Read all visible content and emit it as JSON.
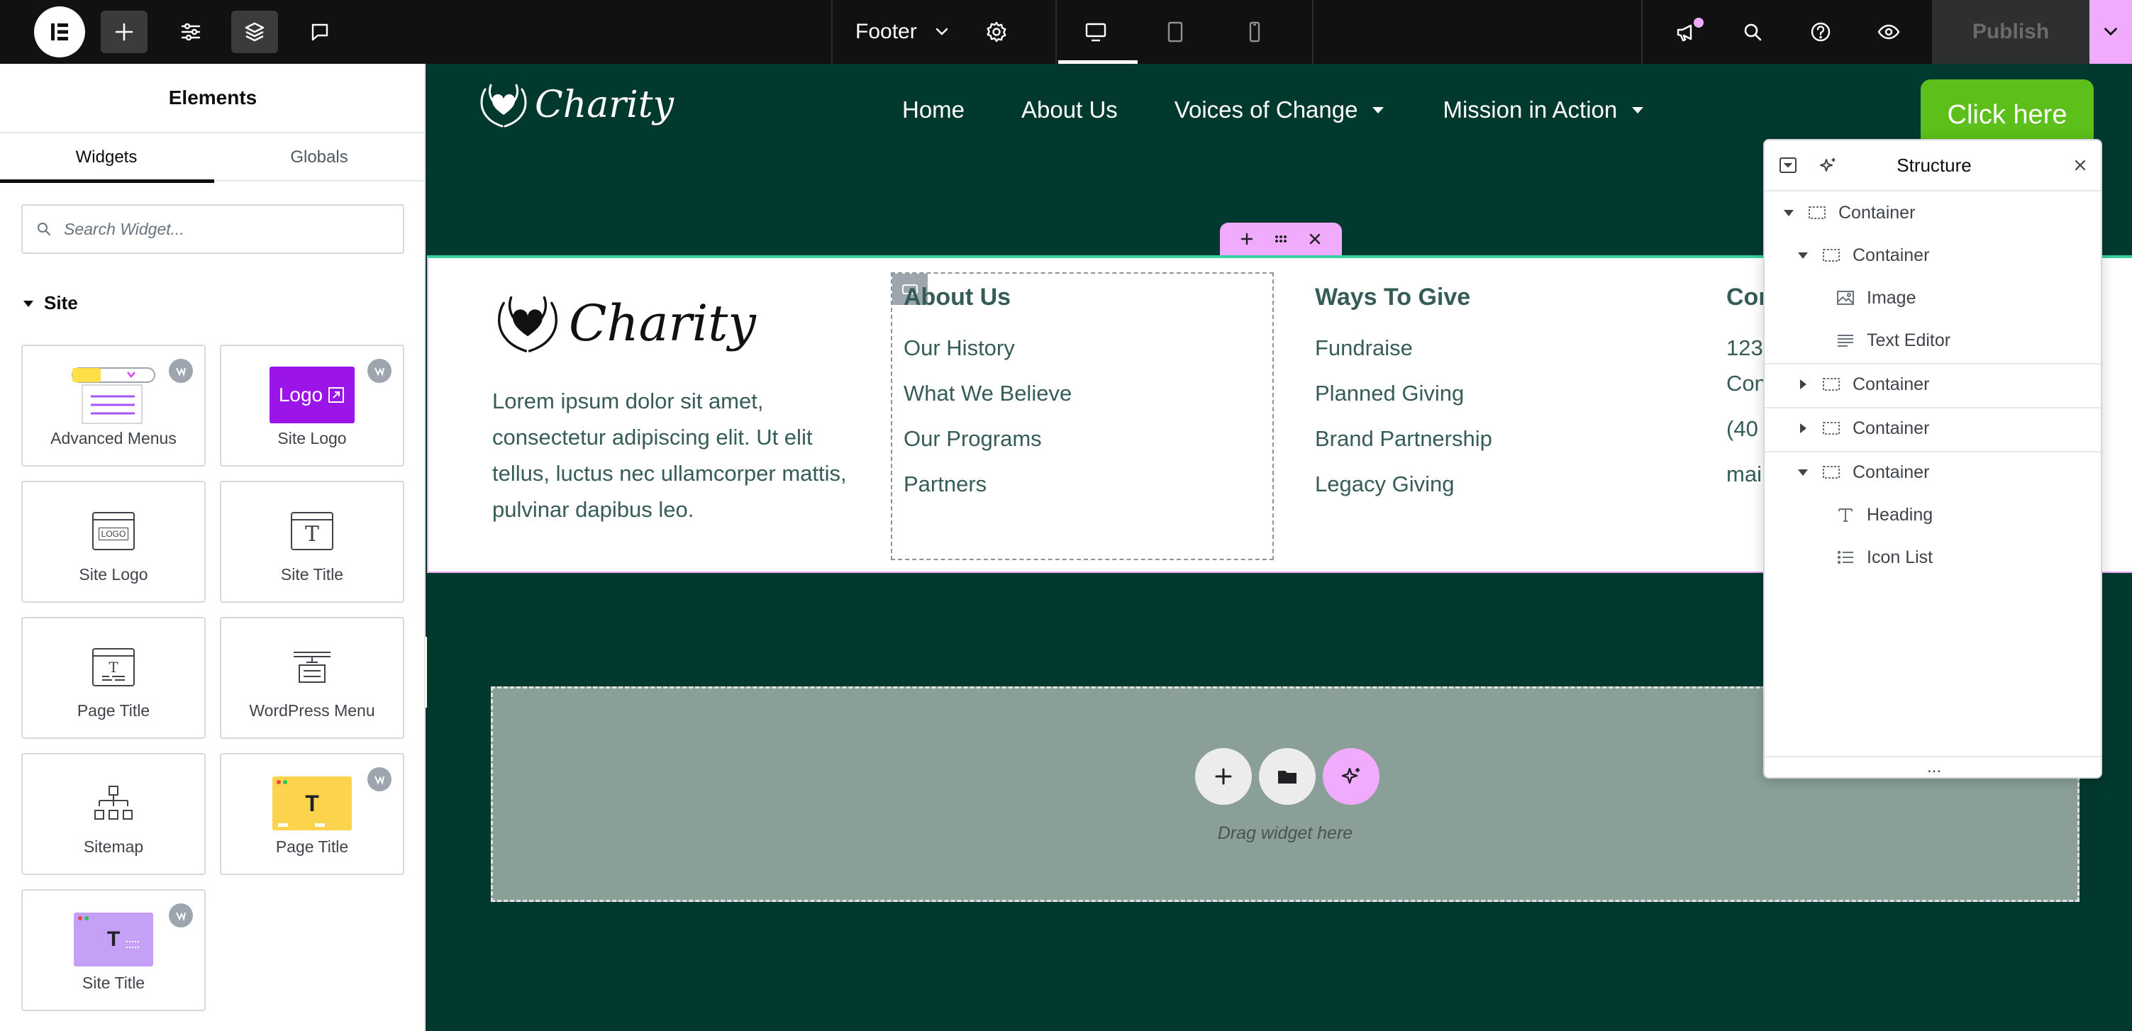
{
  "topbar": {
    "document_name": "Footer",
    "publish_label": "Publish"
  },
  "panel": {
    "title": "Elements",
    "tabs": [
      "Widgets",
      "Globals"
    ],
    "search_placeholder": "Search Widget...",
    "section_title": "Site",
    "widgets": [
      {
        "label": "Advanced Menus",
        "icon": "advanced-menus-icon",
        "pro": true
      },
      {
        "label": "Site Logo",
        "icon": "site-logo-pro-icon",
        "pro": true
      },
      {
        "label": "Site Logo",
        "icon": "site-logo-icon",
        "pro": false
      },
      {
        "label": "Site Title",
        "icon": "site-title-icon",
        "pro": false
      },
      {
        "label": "Page Title",
        "icon": "page-title-icon",
        "pro": false
      },
      {
        "label": "WordPress Menu",
        "icon": "wordpress-menu-icon",
        "pro": false
      },
      {
        "label": "Sitemap",
        "icon": "sitemap-icon",
        "pro": false
      },
      {
        "label": "Page Title",
        "icon": "page-title-pro-icon",
        "pro": true
      },
      {
        "label": "Site Title",
        "icon": "site-title-pro-icon",
        "pro": true
      }
    ],
    "logo_thumb_text": "Logo",
    "logo_small_text": "LOGO",
    "title_glyph": "T"
  },
  "header": {
    "logo_text": "Charity",
    "nav": [
      "Home",
      "About Us",
      "Voices of Change",
      "Mission in Action"
    ],
    "cta_label": "Click here"
  },
  "footer": {
    "logo_text": "Charity",
    "description": "Lorem ipsum dolor sit amet, consectetur adipiscing elit. Ut elit tellus, luctus nec ullamcorper mattis, pulvinar dapibus leo.",
    "columns": [
      {
        "heading": "About Us",
        "links": [
          "Our History",
          "What We Believe",
          "Our Programs",
          "Partners"
        ]
      },
      {
        "heading": "Ways To Give",
        "links": [
          "Fundraise",
          "Planned Giving",
          "Brand Partnership",
          "Legacy Giving"
        ]
      },
      {
        "heading": "Con",
        "links": [
          "123",
          "Con",
          "(40",
          "mai"
        ]
      }
    ]
  },
  "dropzone": {
    "text": "Drag widget here"
  },
  "structure": {
    "title": "Structure",
    "rows": [
      {
        "label": "Container",
        "caret": "down"
      },
      {
        "label": "Container",
        "caret": "down"
      },
      {
        "label": "Image",
        "caret": "none"
      },
      {
        "label": "Text Editor",
        "caret": "none"
      },
      {
        "label": "Container",
        "caret": "right"
      },
      {
        "label": "Container",
        "caret": "right"
      },
      {
        "label": "Container",
        "caret": "down"
      },
      {
        "label": "Heading",
        "caret": "none"
      },
      {
        "label": "Icon List",
        "caret": "none"
      }
    ],
    "footer_glyph": "..."
  },
  "colors": {
    "brand_pink": "#f0abfc",
    "canvas_green": "#02392f",
    "cta_green": "#5cbf1a",
    "footer_text": "#355c57"
  }
}
